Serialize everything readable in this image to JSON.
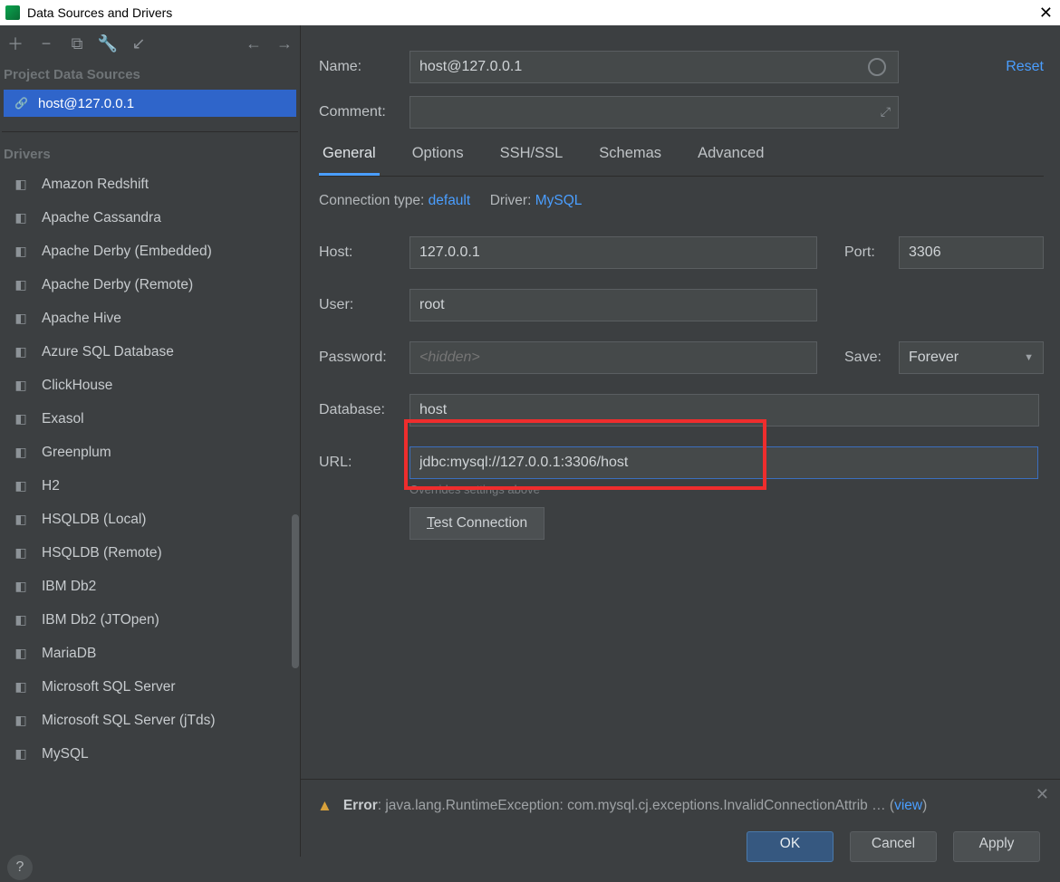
{
  "window": {
    "title": "Data Sources and Drivers"
  },
  "sidebar": {
    "section_project": "Project Data Sources",
    "datasources": [
      {
        "label": "host@127.0.0.1",
        "selected": true
      }
    ],
    "section_drivers": "Drivers",
    "drivers": [
      "Amazon Redshift",
      "Apache Cassandra",
      "Apache Derby (Embedded)",
      "Apache Derby (Remote)",
      "Apache Hive",
      "Azure SQL Database",
      "ClickHouse",
      "Exasol",
      "Greenplum",
      "H2",
      "HSQLDB (Local)",
      "HSQLDB (Remote)",
      "IBM Db2",
      "IBM Db2 (JTOpen)",
      "MariaDB",
      "Microsoft SQL Server",
      "Microsoft SQL Server (jTds)",
      "MySQL"
    ]
  },
  "form": {
    "name_label": "Name:",
    "name_value": "host@127.0.0.1",
    "reset": "Reset",
    "comment_label": "Comment:",
    "comment_value": "",
    "tabs": [
      "General",
      "Options",
      "SSH/SSL",
      "Schemas",
      "Advanced"
    ],
    "active_tab": "General",
    "conn_type_label": "Connection type:",
    "conn_type_value": "default",
    "driver_label": "Driver:",
    "driver_value": "MySQL",
    "host_label": "Host:",
    "host_value": "127.0.0.1",
    "port_label": "Port:",
    "port_value": "3306",
    "user_label": "User:",
    "user_value": "root",
    "password_label": "Password:",
    "password_placeholder": "<hidden>",
    "save_label": "Save:",
    "save_value": "Forever",
    "database_label": "Database:",
    "database_value": "host",
    "url_label": "URL:",
    "url_value": "jdbc:mysql://127.0.0.1:3306/host",
    "overrides_hint": "Overrides settings above",
    "test_connection": "Test Connection"
  },
  "status": {
    "error_label": "Error",
    "error_text": ": java.lang.RuntimeException: com.mysql.cj.exceptions.InvalidConnectionAttrib … (",
    "view": "view",
    "close_paren": ")"
  },
  "buttons": {
    "ok": "OK",
    "cancel": "Cancel",
    "apply": "Apply"
  }
}
